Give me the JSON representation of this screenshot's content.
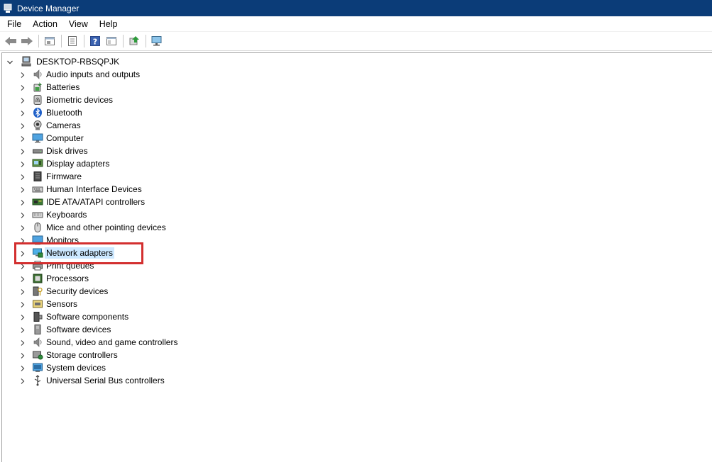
{
  "window": {
    "title": "Device Manager"
  },
  "menubar": {
    "items": [
      "File",
      "Action",
      "View",
      "Help"
    ]
  },
  "toolbar": {
    "buttons": [
      "back-arrow-icon",
      "forward-arrow-icon",
      "properties-sheet-icon",
      "device-list-icon",
      "help-icon",
      "console-tree-icon",
      "update-driver-icon",
      "scan-hardware-icon"
    ]
  },
  "tree": {
    "root": {
      "label": "DESKTOP-RBSQPJK",
      "icon": "computer-icon",
      "expanded": true
    },
    "categories": [
      {
        "label": "Audio inputs and outputs",
        "icon": "speaker-icon"
      },
      {
        "label": "Batteries",
        "icon": "battery-icon"
      },
      {
        "label": "Biometric devices",
        "icon": "fingerprint-icon"
      },
      {
        "label": "Bluetooth",
        "icon": "bluetooth-icon"
      },
      {
        "label": "Cameras",
        "icon": "camera-icon"
      },
      {
        "label": "Computer",
        "icon": "monitor-icon"
      },
      {
        "label": "Disk drives",
        "icon": "disk-drive-icon"
      },
      {
        "label": "Display adapters",
        "icon": "display-adapter-icon"
      },
      {
        "label": "Firmware",
        "icon": "firmware-chip-icon"
      },
      {
        "label": "Human Interface Devices",
        "icon": "hid-icon"
      },
      {
        "label": "IDE ATA/ATAPI controllers",
        "icon": "ide-controller-icon"
      },
      {
        "label": "Keyboards",
        "icon": "keyboard-icon"
      },
      {
        "label": "Mice and other pointing devices",
        "icon": "mouse-icon"
      },
      {
        "label": "Monitors",
        "icon": "monitor-icon"
      },
      {
        "label": "Network adapters",
        "icon": "network-adapter-icon",
        "selected": true
      },
      {
        "label": "Print queues",
        "icon": "printer-icon"
      },
      {
        "label": "Processors",
        "icon": "processor-icon"
      },
      {
        "label": "Security devices",
        "icon": "security-key-icon"
      },
      {
        "label": "Sensors",
        "icon": "sensor-icon"
      },
      {
        "label": "Software components",
        "icon": "software-component-icon"
      },
      {
        "label": "Software devices",
        "icon": "software-device-icon"
      },
      {
        "label": "Sound, video and game controllers",
        "icon": "speaker-icon"
      },
      {
        "label": "Storage controllers",
        "icon": "storage-controller-icon"
      },
      {
        "label": "System devices",
        "icon": "system-device-icon"
      },
      {
        "label": "Universal Serial Bus controllers",
        "icon": "usb-icon"
      }
    ]
  },
  "colors": {
    "titlebar": "#0b3c78",
    "selection": "#cce8ff",
    "highlight_box": "#d32f2f"
  }
}
